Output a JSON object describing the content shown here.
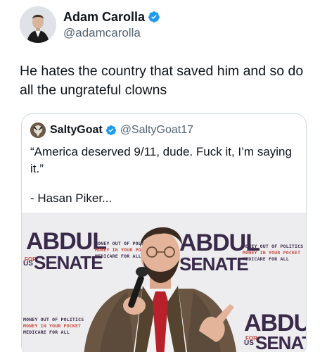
{
  "author": {
    "display_name": "Adam Carolla",
    "handle": "@adamcarolla",
    "verified": true,
    "avatar_icon": "profile-photo"
  },
  "tweet": {
    "text": "He hates the country that saved him and so do all the ungrateful clowns"
  },
  "quoted": {
    "display_name": "SaltyGoat",
    "handle": "@SaltyGoat17",
    "verified": true,
    "text": "“America deserved 9/11, dude. Fuck it, I’m saying it.”",
    "signature": "- Hasan Piker...",
    "image": {
      "banner_big_1": "ABDUL",
      "banner_for": "FOR",
      "banner_us": "US",
      "banner_senate": "SENATE",
      "banner_small_line1": "MONEY OUT OF POLITICS",
      "banner_small_line2": "MONEY IN YOUR POCKET",
      "banner_small_line3": "MEDICARE FOR ALL"
    }
  },
  "colors": {
    "verified": "#1d9bf0",
    "text": "#0f1419",
    "secondary": "#536471",
    "border": "#cfd9de"
  }
}
